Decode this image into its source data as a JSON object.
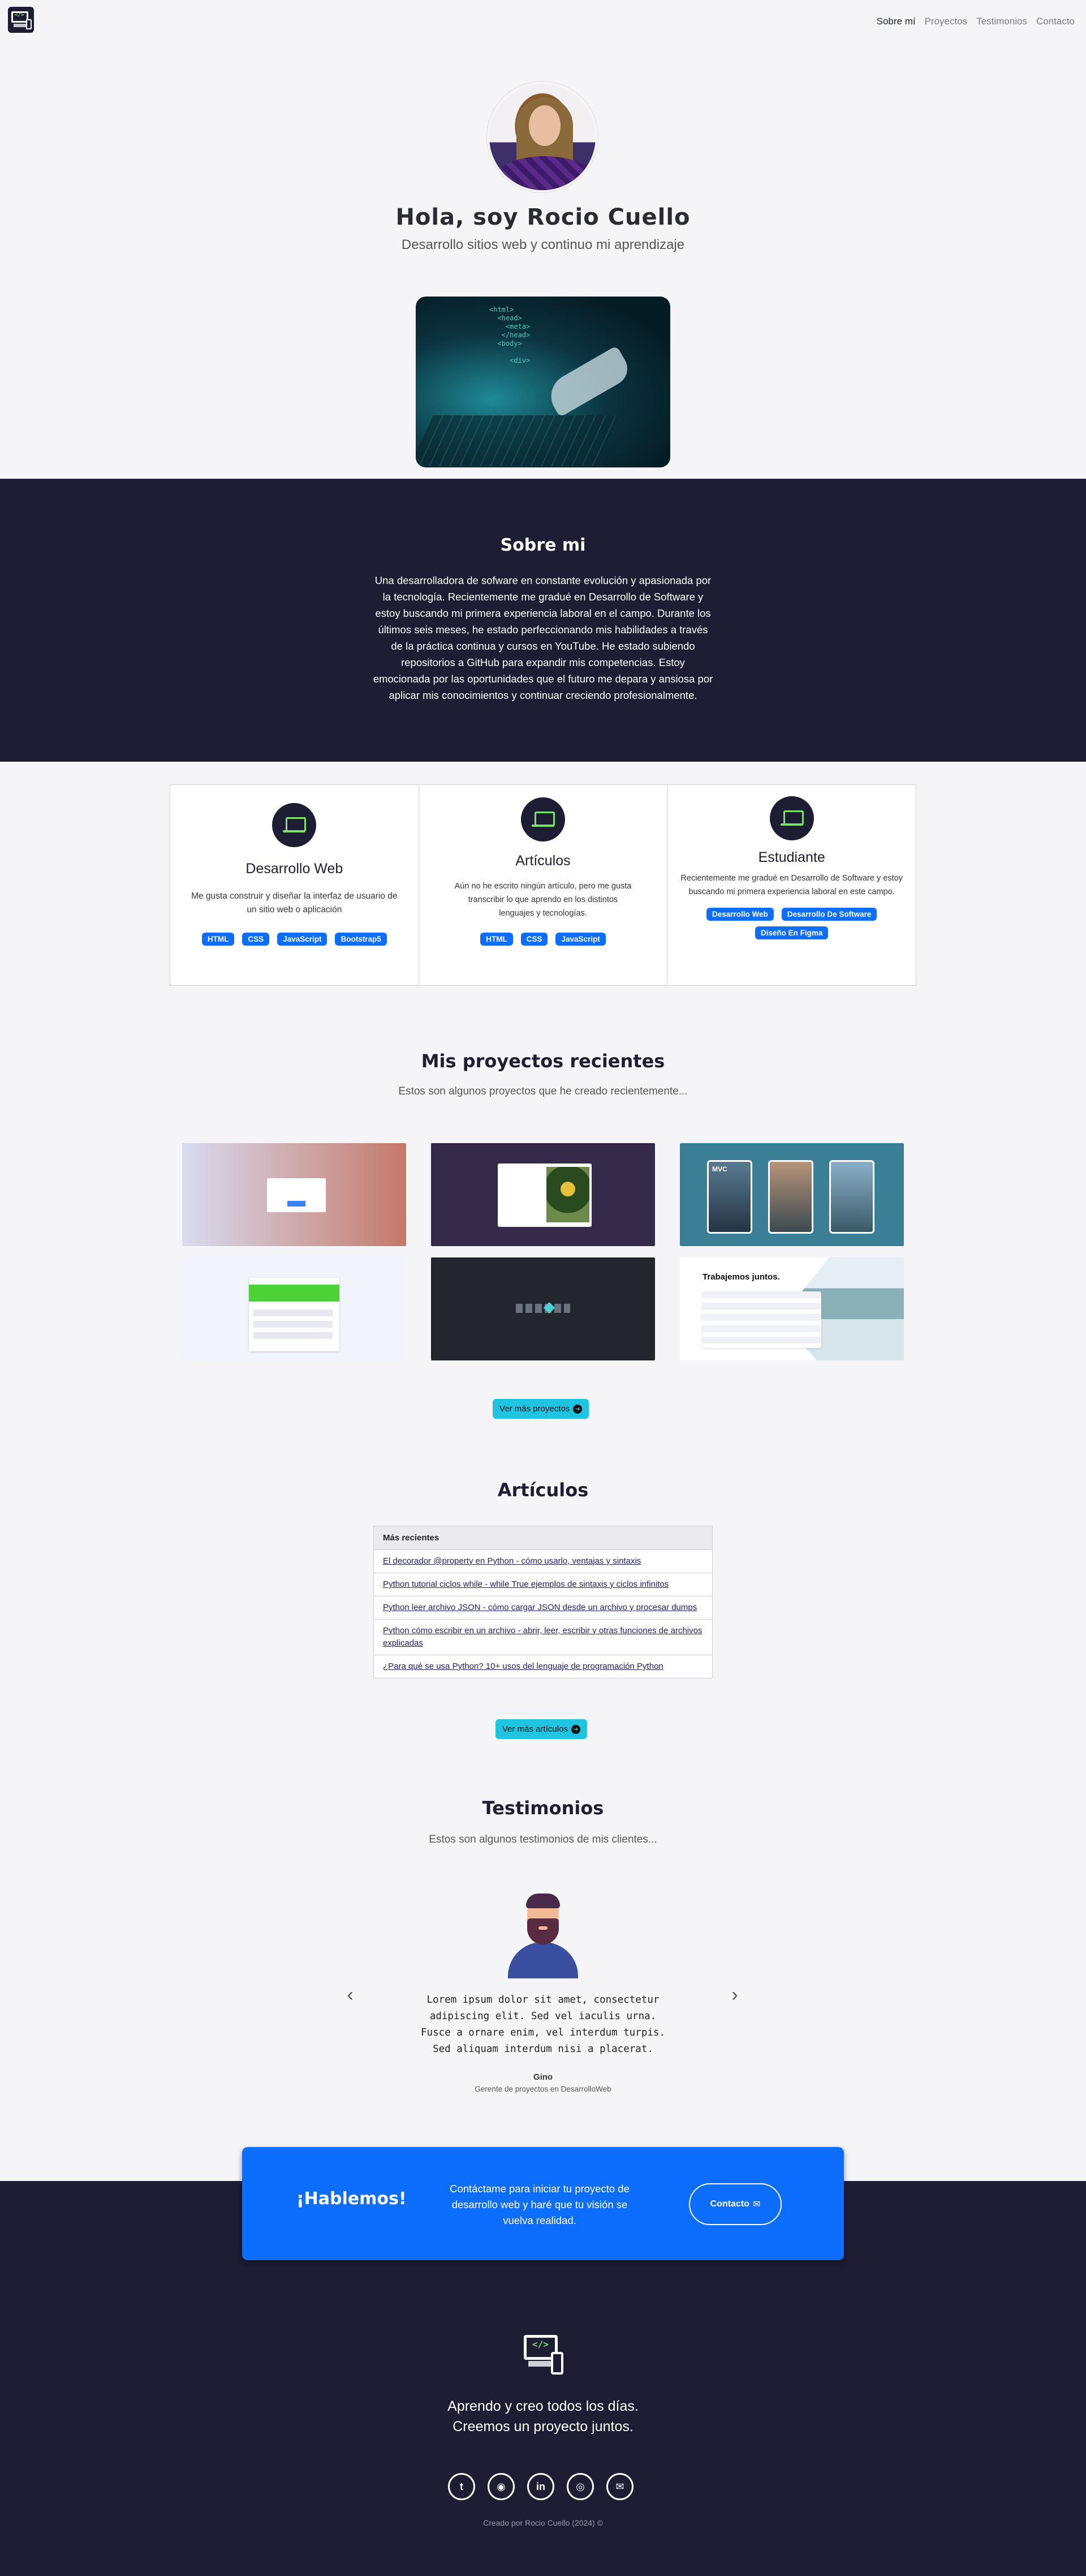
{
  "nav": {
    "links": [
      "Sobre mí",
      "Proyectos",
      "Testimonios",
      "Contacto"
    ]
  },
  "hero": {
    "title": "Hola, soy Rocio Cuello",
    "subtitle": "Desarrollo sitios web y continuo mi aprendizaje"
  },
  "about": {
    "title": "Sobre mi",
    "text": "Una desarrolladora de sofware en constante evolución y apasionada por la tecnología. Recientemente me gradué en Desarrollo de Software y estoy buscando mi primera experiencia laboral en el campo. Durante los últimos seis meses, he estado perfeccionando mis habilidades a través de la práctica continua y cursos en YouTube. He estado subiendo repositorios a GitHub para expandir mis competencias. Estoy emocionada por las oportunidades que el futuro me depara y ansiosa por aplicar mis conocimientos y continuar creciendo profesionalmente."
  },
  "cards": [
    {
      "title": "Desarrollo Web",
      "text": "Me gusta construir y diseñar la interfaz de usuario de un sitio web o aplicación",
      "tags": [
        "HTML",
        "CSS",
        "JavaScript",
        "Bootstrap5"
      ]
    },
    {
      "title": "Artículos",
      "text": "Aún no he escrito ningún artículo, pero me gusta transcribir lo que aprendo en los distintos lenguajes y tecnologías.",
      "tags": [
        "HTML",
        "CSS",
        "JavaScript"
      ]
    },
    {
      "title": "Estudiante",
      "text": "Recientemente me gradué en Desarrollo de Software y estoy buscando mi primera experiencia laboral en este campo.",
      "tags": [
        "Desarrollo Web",
        "Desarrollo De Software",
        "Diseño En Figma"
      ]
    }
  ],
  "projects": {
    "title": "Mis proyectos recientes",
    "subtitle": "Estos son algunos proyectos que he creado recientemente...",
    "thumb_texts": {
      "mvc": "MVC",
      "trabajemos": "Trabajemos juntos."
    },
    "more_label": "Ver más proyectos"
  },
  "articles": {
    "title": "Artículos",
    "list_header": "Más recientes",
    "items": [
      "El decorador @property en Python - cómo usarlo, ventajas y sintaxis",
      "Python tutorial ciclos while - while True ejemplos de sintaxis y ciclos infinitos",
      "Python leer archivo JSON - cómo cargar JSON desde un archivo y procesar dumps",
      "Python cómo escribir en un archivo - abrir, leer, escribir y otras funciones de archivos explicadas",
      "¿Para qué se usa Python? 10+ usos del lenguaje de programación Python"
    ],
    "more_label": "Ver más artículos"
  },
  "testimonials": {
    "title": "Testimonios",
    "subtitle": "Estos son algunos testimonios de mis clientes...",
    "quote": "Lorem ipsum dolor sit amet, consectetur adipiscing elit. Sed vel iaculis urna. Fusce a ornare enim, vel interdum turpis. Sed aliquam interdum nisi a placerat.",
    "name": "Gino",
    "role": "Gerente de proyectos en DesarrolloWeb"
  },
  "cta": {
    "title": "¡Hablemos!",
    "text": "Contáctame para iniciar tu proyecto de desarrollo web y haré que tu visión se vuelva realidad.",
    "button_label": "Contacto"
  },
  "footer": {
    "line1": "Aprendo y creo todos los días.",
    "line2": "Creemos un proyecto juntos.",
    "credit": "Creado por Rocio Cuello (2024) ©",
    "social_icons": [
      "twitter-icon",
      "github-icon",
      "linkedin-icon",
      "instagram-icon",
      "email-icon"
    ]
  },
  "colors": {
    "dark": "#1d1d34",
    "accent": "#0d6efd",
    "cyan": "#1fc5e0",
    "green": "#7ee36a"
  }
}
